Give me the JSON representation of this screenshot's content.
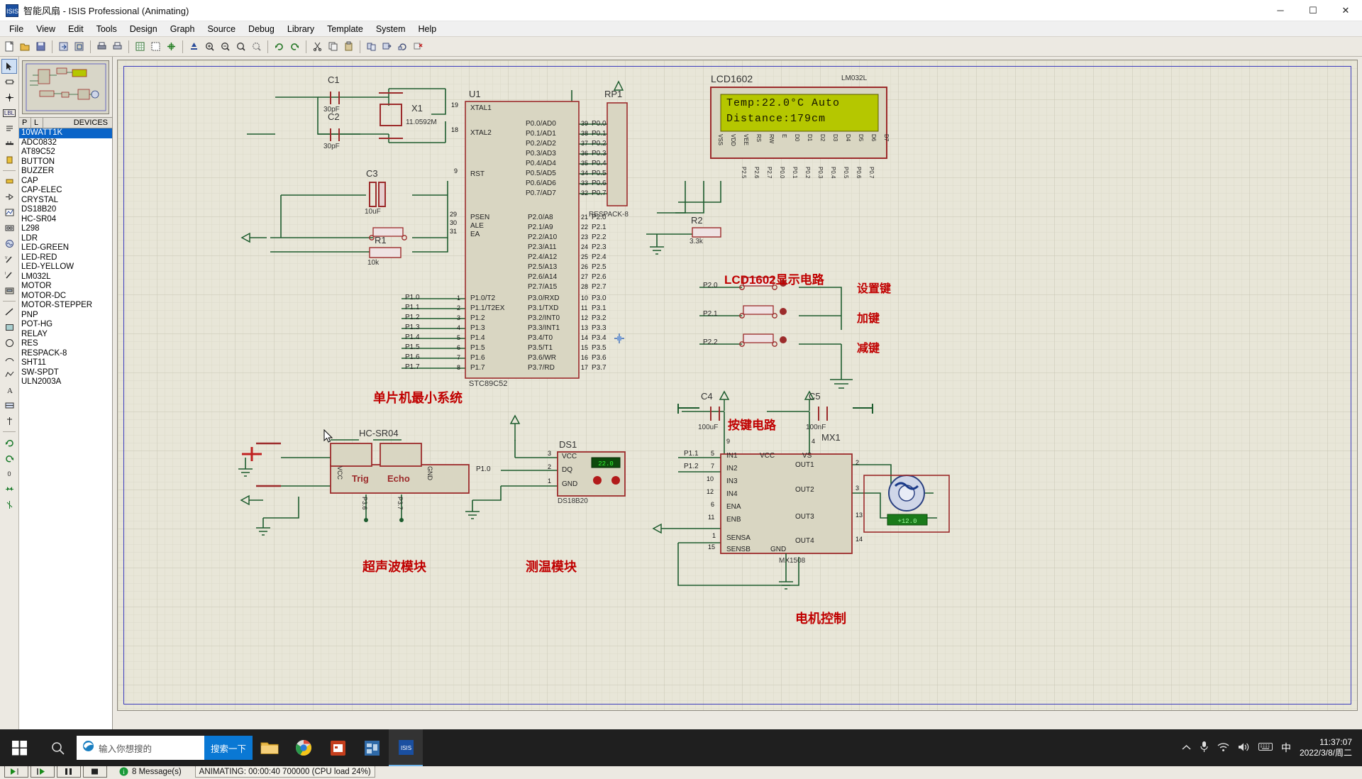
{
  "window": {
    "title": "智能风扇 - ISIS Professional (Animating)",
    "app_icon": "isis-icon",
    "minimize": "─",
    "maximize": "☐",
    "close": "✕"
  },
  "menu": {
    "items": [
      "File",
      "View",
      "Edit",
      "Tools",
      "Design",
      "Graph",
      "Source",
      "Debug",
      "Library",
      "Template",
      "System",
      "Help"
    ]
  },
  "devices_panel": {
    "col_p": "P",
    "col_l": "L",
    "col_devices": "DEVICES",
    "items": [
      {
        "name": "10WATT1K",
        "selected": true
      },
      {
        "name": "ADC0832",
        "selected": false
      },
      {
        "name": "AT89C52",
        "selected": false
      },
      {
        "name": "BUTTON",
        "selected": false
      },
      {
        "name": "BUZZER",
        "selected": false
      },
      {
        "name": "CAP",
        "selected": false
      },
      {
        "name": "CAP-ELEC",
        "selected": false
      },
      {
        "name": "CRYSTAL",
        "selected": false
      },
      {
        "name": "DS18B20",
        "selected": false
      },
      {
        "name": "HC-SR04",
        "selected": false
      },
      {
        "name": "L298",
        "selected": false
      },
      {
        "name": "LDR",
        "selected": false
      },
      {
        "name": "LED-GREEN",
        "selected": false
      },
      {
        "name": "LED-RED",
        "selected": false
      },
      {
        "name": "LED-YELLOW",
        "selected": false
      },
      {
        "name": "LM032L",
        "selected": false
      },
      {
        "name": "MOTOR",
        "selected": false
      },
      {
        "name": "MOTOR-DC",
        "selected": false
      },
      {
        "name": "MOTOR-STEPPER",
        "selected": false
      },
      {
        "name": "PNP",
        "selected": false
      },
      {
        "name": "POT-HG",
        "selected": false
      },
      {
        "name": "RELAY",
        "selected": false
      },
      {
        "name": "RES",
        "selected": false
      },
      {
        "name": "RESPACK-8",
        "selected": false
      },
      {
        "name": "SHT11",
        "selected": false
      },
      {
        "name": "SW-SPDT",
        "selected": false
      },
      {
        "name": "ULN2003A",
        "selected": false
      }
    ]
  },
  "schematic": {
    "section_titles": [
      {
        "text": "单片机最小系统"
      },
      {
        "text": "LCD1602显示电路"
      },
      {
        "text": "按键电路"
      },
      {
        "text": "超声波模块"
      },
      {
        "text": "测温模块"
      },
      {
        "text": "电机控制"
      }
    ],
    "u1": {
      "ref": "U1",
      "part": "STC89C52",
      "left_pins": [
        {
          "num": "19",
          "name": "XTAL1"
        },
        {
          "num": "18",
          "name": "XTAL2"
        },
        {
          "num": "9",
          "name": "RST"
        },
        {
          "num": "29",
          "name": "PSEN"
        },
        {
          "num": "30",
          "name": "ALE"
        },
        {
          "num": "31",
          "name": "EA"
        },
        {
          "num": "1",
          "name": "P1.0/T2"
        },
        {
          "num": "2",
          "name": "P1.1/T2EX"
        },
        {
          "num": "3",
          "name": "P1.2"
        },
        {
          "num": "4",
          "name": "P1.3"
        },
        {
          "num": "5",
          "name": "P1.4"
        },
        {
          "num": "6",
          "name": "P1.5"
        },
        {
          "num": "7",
          "name": "P1.6"
        },
        {
          "num": "8",
          "name": "P1.7"
        }
      ],
      "left_net_labels": [
        "P1.0",
        "P1.1",
        "P1.2",
        "P1.3",
        "P1.4",
        "P1.5",
        "P1.6",
        "P1.7"
      ],
      "p0_pins": [
        {
          "num": "39",
          "name": "P0.0/AD0",
          "net": "P0.0"
        },
        {
          "num": "38",
          "name": "P0.1/AD1",
          "net": "P0.1"
        },
        {
          "num": "37",
          "name": "P0.2/AD2",
          "net": "P0.2"
        },
        {
          "num": "36",
          "name": "P0.3/AD3",
          "net": "P0.3"
        },
        {
          "num": "35",
          "name": "P0.4/AD4",
          "net": "P0.4"
        },
        {
          "num": "34",
          "name": "P0.5/AD5",
          "net": "P0.5"
        },
        {
          "num": "33",
          "name": "P0.6/AD6",
          "net": "P0.6"
        },
        {
          "num": "32",
          "name": "P0.7/AD7",
          "net": "P0.7"
        }
      ],
      "p2_pins": [
        {
          "num": "21",
          "name": "P2.0/A8",
          "net": "P2.0"
        },
        {
          "num": "22",
          "name": "P2.1/A9",
          "net": "P2.1"
        },
        {
          "num": "23",
          "name": "P2.2/A10",
          "net": "P2.2"
        },
        {
          "num": "24",
          "name": "P2.3/A11",
          "net": "P2.3"
        },
        {
          "num": "25",
          "name": "P2.4/A12",
          "net": "P2.4"
        },
        {
          "num": "26",
          "name": "P2.5/A13",
          "net": "P2.5"
        },
        {
          "num": "27",
          "name": "P2.6/A14",
          "net": "P2.6"
        },
        {
          "num": "28",
          "name": "P2.7/A15",
          "net": "P2.7"
        }
      ],
      "p3_pins": [
        {
          "num": "10",
          "name": "P3.0/RXD",
          "net": "P3.0"
        },
        {
          "num": "11",
          "name": "P3.1/TXD",
          "net": "P3.1"
        },
        {
          "num": "12",
          "name": "P3.2/INT0",
          "net": "P3.2"
        },
        {
          "num": "13",
          "name": "P3.3/INT1",
          "net": "P3.3"
        },
        {
          "num": "14",
          "name": "P3.4/T0",
          "net": "P3.4"
        },
        {
          "num": "15",
          "name": "P3.5/T1",
          "net": "P3.5"
        },
        {
          "num": "16",
          "name": "P3.6/WR",
          "net": "P3.6"
        },
        {
          "num": "17",
          "name": "P3.7/RD",
          "net": "P3.7"
        }
      ]
    },
    "components": [
      {
        "ref": "C1",
        "value": "30pF"
      },
      {
        "ref": "C2",
        "value": "30pF"
      },
      {
        "ref": "X1",
        "value": "11.0592M"
      },
      {
        "ref": "C3",
        "value": "10uF"
      },
      {
        "ref": "R1",
        "value": "10k"
      },
      {
        "ref": "R2",
        "value": "3.3k"
      },
      {
        "ref": "C4",
        "value": "100uF"
      },
      {
        "ref": "C5",
        "value": "100nF"
      },
      {
        "ref": "RP1",
        "value": "RESPACK-8"
      },
      {
        "ref": "DS1",
        "value": "DS18B20"
      },
      {
        "ref": "MX1",
        "value": "MX1508"
      }
    ],
    "lcd": {
      "ref": "LCD1602",
      "part": "LM032L",
      "line1": "Temp:22.0°C Auto",
      "line2": "Distance:179cm",
      "pins": [
        "VSS",
        "VDD",
        "VEE",
        "RS",
        "RW",
        "E",
        "D0",
        "D1",
        "D2",
        "D3",
        "D4",
        "D5",
        "D6",
        "D7"
      ],
      "pin_nets": [
        "",
        "",
        "",
        "P2.5",
        "P2.6",
        "P2.7",
        "P0.0",
        "P0.1",
        "P0.2",
        "P0.3",
        "P0.4",
        "P0.5",
        "P0.6",
        "P0.7"
      ]
    },
    "keys": [
      {
        "net": "P2.0",
        "label": "设置键"
      },
      {
        "net": "P2.1",
        "label": "加键"
      },
      {
        "net": "P2.2",
        "label": "减键"
      }
    ],
    "hcsr04": {
      "ref": "HC-SR04",
      "pins": [
        "VCC",
        "Trig",
        "Echo",
        "GND"
      ],
      "nets": [
        "",
        "P3.6",
        "P3.7",
        ""
      ]
    },
    "ds18b20": {
      "ref": "DS1",
      "part": "DS18B20",
      "pins": [
        {
          "num": "3",
          "name": "VCC"
        },
        {
          "num": "2",
          "name": "DQ"
        },
        {
          "num": "1",
          "name": "GND"
        }
      ],
      "net": "P1.0",
      "readout": "22.0"
    },
    "driver": {
      "ref": "MX1",
      "part": "MX1508",
      "in_pins": [
        {
          "num": "5",
          "name": "IN1",
          "net": "P1.1"
        },
        {
          "num": "7",
          "name": "IN2",
          "net": "P1.2"
        },
        {
          "num": "10",
          "name": "IN3",
          "net": ""
        },
        {
          "num": "12",
          "name": "IN4",
          "net": ""
        },
        {
          "num": "6",
          "name": "ENA",
          "net": ""
        },
        {
          "num": "11",
          "name": "ENB",
          "net": ""
        },
        {
          "num": "1",
          "name": "SENSA",
          "net": ""
        },
        {
          "num": "15",
          "name": "SENSB",
          "net": ""
        }
      ],
      "out_pins": [
        {
          "num": "2",
          "name": "OUT1"
        },
        {
          "num": "3",
          "name": "OUT2"
        },
        {
          "num": "13",
          "name": "OUT3"
        },
        {
          "num": "14",
          "name": "OUT4"
        }
      ],
      "power_pins": [
        {
          "num": "9",
          "name": "VCC"
        },
        {
          "num": "4",
          "name": "VS"
        }
      ],
      "gnd": "GND",
      "motor_label": "MOTOR"
    }
  },
  "playback": {
    "play": "play-button",
    "step": "step-button",
    "pause": "pause-button",
    "stop": "stop-button"
  },
  "statusbar": {
    "messages": "8 Message(s)",
    "animating": "ANIMATING: 00:00:40 700000 (CPU load 24%)"
  },
  "taskbar": {
    "start": "start-button",
    "search_icon": "search-icon",
    "search_placeholder": "输入你想搜的",
    "search_button": "搜索一下",
    "apps": [
      {
        "name": "file-explorer-icon"
      },
      {
        "name": "chrome-icon"
      },
      {
        "name": "powerpoint-icon"
      },
      {
        "name": "proteus-ares-icon"
      },
      {
        "name": "proteus-isis-icon"
      }
    ],
    "tray": [
      "chevron-up-icon",
      "microphone-icon",
      "wifi-icon",
      "volume-icon",
      "keyboard-icon"
    ],
    "ime": "中",
    "time": "11:37:07",
    "date": "2022/3/8/周二"
  },
  "colors": {
    "wire": "#1d5c2e",
    "body_fill": "#d9d6c2",
    "body_border": "#9c2b2b",
    "canvas_bg": "#e8e6d8",
    "accent_red": "#c00000",
    "lcd_screen": "#b5c700",
    "select_blue": "#0a64c8"
  }
}
